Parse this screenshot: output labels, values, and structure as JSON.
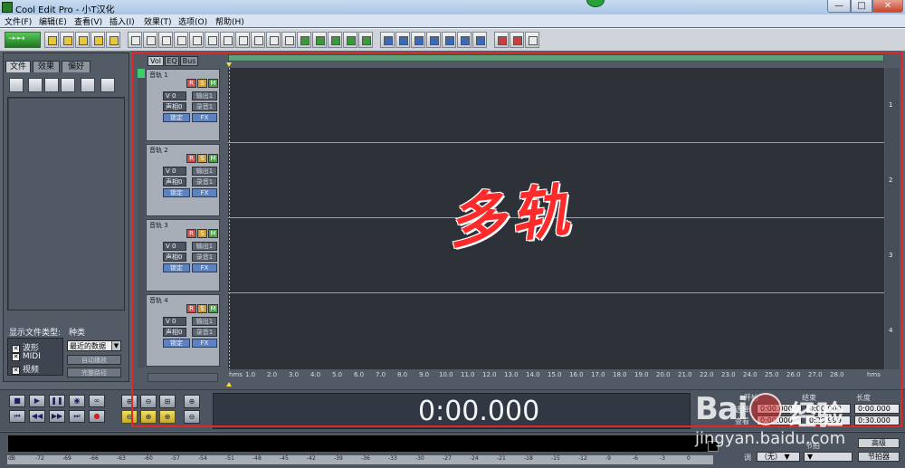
{
  "window": {
    "title": "Cool Edit Pro  - 小T汉化",
    "minimize": "—",
    "maximize": "□",
    "close": "✕"
  },
  "menu": [
    "文件(F)",
    "编辑(E)",
    "查看(V)",
    "插入(I)",
    "效果(T)",
    "选项(O)",
    "帮助(H)"
  ],
  "left_panel": {
    "tabs": [
      "文件",
      "效果",
      "偏好"
    ],
    "show_types_label": "显示文件类型:",
    "types": [
      {
        "label": "波形",
        "checked": "✕"
      },
      {
        "label": "MIDI",
        "checked": "✕"
      },
      {
        "label": "视频",
        "checked": "✕"
      }
    ],
    "sort_label": "种类",
    "sort_value": "最近的数据",
    "auto_play": "自动播放",
    "full_path": "完整路径"
  },
  "track_area": {
    "view_tabs": [
      "Vol",
      "EQ",
      "Bus"
    ],
    "tracks": [
      {
        "name": "音轨 1",
        "vol": "V 0",
        "pan": "声相0",
        "out": "输出1",
        "rec": "录音1",
        "lock": "锁定",
        "fx": "FX",
        "num": "1"
      },
      {
        "name": "音轨 2",
        "vol": "V 0",
        "pan": "声相0",
        "out": "输出1",
        "rec": "录音1",
        "lock": "锁定",
        "fx": "FX",
        "num": "2"
      },
      {
        "name": "音轨 3",
        "vol": "V 0",
        "pan": "声相0",
        "out": "输出1",
        "rec": "录音1",
        "lock": "锁定",
        "fx": "FX",
        "num": "3"
      },
      {
        "name": "音轨 4",
        "vol": "V 0",
        "pan": "声相0",
        "out": "输出1",
        "rec": "录音1",
        "lock": "锁定",
        "fx": "FX",
        "num": "4"
      }
    ],
    "rsm": [
      "R",
      "S",
      "M"
    ],
    "ruler_unit": "hms",
    "ruler_ticks": [
      "1.0",
      "2.0",
      "3.0",
      "4.0",
      "5.0",
      "6.0",
      "7.0",
      "8.0",
      "9.0",
      "10.0",
      "11.0",
      "12.0",
      "13.0",
      "14.0",
      "15.0",
      "16.0",
      "17.0",
      "18.0",
      "19.0",
      "20.0",
      "21.0",
      "22.0",
      "23.0",
      "24.0",
      "25.0",
      "26.0",
      "27.0",
      "28.0"
    ],
    "ruler_end": "hms"
  },
  "overlay_text": "多轨",
  "transport": {
    "time": "0:00.000",
    "buttons_row1": [
      "■",
      "▶",
      "❚❚",
      "◉",
      "∞"
    ],
    "buttons_row2": [
      "⏮",
      "◀◀",
      "▶▶",
      "⏭",
      "●"
    ],
    "zoom_row1": [
      "⊕",
      "⊖",
      "⊞",
      "⊕"
    ],
    "zoom_row2": [
      "⊖",
      "⊕",
      "⊕",
      "⊖"
    ]
  },
  "info": {
    "start_label": "开始",
    "end_label": "结束",
    "length_label": "长度",
    "sel_label": "选择",
    "view_label": "查看",
    "sel_start": "0:00.000",
    "sel_end": "0:00.000",
    "sel_length": "0:00.000",
    "view_start": "0:00.000",
    "view_end": "0:29.999",
    "view_length": "0:30.000"
  },
  "meter": {
    "ticks": [
      "dB",
      "-72",
      "-69",
      "-66",
      "-63",
      "-60",
      "-57",
      "-54",
      "-51",
      "-48",
      "-45",
      "-42",
      "-39",
      "-36",
      "-33",
      "-30",
      "-27",
      "-24",
      "-21",
      "-18",
      "-15",
      "-12",
      "-9",
      "-6",
      "-3",
      "0"
    ]
  },
  "bottom_right": {
    "key_label": "调",
    "key_value": "（无）",
    "tempo_label": "节拍",
    "advanced": "高级",
    "metronome": "节拍器"
  },
  "watermark": {
    "bai": "Bai",
    "jingyan": "经验",
    "url": "jingyan.baidu.com"
  }
}
